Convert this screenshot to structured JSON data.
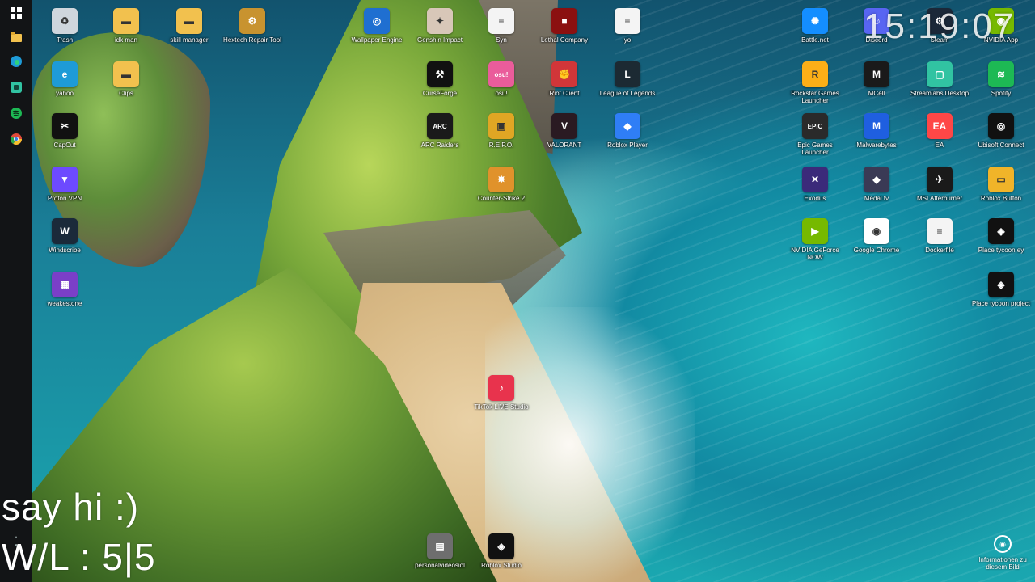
{
  "clock": "15:19:07",
  "overlay": {
    "line1": "say hi :)",
    "line2": "W/L : 5|5"
  },
  "info_corner": {
    "label": "Informationen zu diesem Bild"
  },
  "icons": [
    {
      "label": "Trash",
      "icon": "recycle-bin-icon",
      "color": "#cfd6dd",
      "glyph": "♻"
    },
    {
      "label": "idk man",
      "icon": "folder-icon",
      "color": "#f2c14e",
      "glyph": "▬"
    },
    {
      "label": "skill manager",
      "icon": "folder-icon",
      "color": "#f2c14e",
      "glyph": "▬"
    },
    {
      "label": "Hextech Repair Tool",
      "icon": "hextech-icon",
      "color": "#c8932f",
      "glyph": "⚙"
    },
    {
      "label": "Wallpaper Engine",
      "icon": "wallpaper-engine-icon",
      "color": "#1f6fd1",
      "glyph": "◎"
    },
    {
      "label": "Genshin Impact",
      "icon": "genshin-icon",
      "color": "#d8c7b8",
      "glyph": "✦"
    },
    {
      "label": "Syn",
      "icon": "document-icon",
      "color": "#f4f4f4",
      "glyph": "≡"
    },
    {
      "label": "Lethal Company",
      "icon": "lethal-company-icon",
      "color": "#8b1010",
      "glyph": "■"
    },
    {
      "label": "yo",
      "icon": "document-icon",
      "color": "#f4f4f4",
      "glyph": "≡"
    },
    {
      "label": "yahoo",
      "icon": "edge-icon",
      "color": "#1e9bd7",
      "glyph": "e"
    },
    {
      "label": "Clips",
      "icon": "folder-icon",
      "color": "#f2c14e",
      "glyph": "▬"
    },
    {
      "label": "CurseForge",
      "icon": "curseforge-icon",
      "color": "#111111",
      "glyph": "⚒"
    },
    {
      "label": "osu!",
      "icon": "osu-icon",
      "color": "#ea5c9b",
      "glyph": "osu!"
    },
    {
      "label": "Riot Client",
      "icon": "riot-client-icon",
      "color": "#d13639",
      "glyph": "✊"
    },
    {
      "label": "League of Legends",
      "icon": "league-icon",
      "color": "#1c2a33",
      "glyph": "L"
    },
    {
      "label": "CapCut",
      "icon": "capcut-icon",
      "color": "#111111",
      "glyph": "✂"
    },
    {
      "label": "ARC Raiders",
      "icon": "arc-raiders-icon",
      "color": "#1a1a1a",
      "glyph": "ARC"
    },
    {
      "label": "R.E.P.O.",
      "icon": "repo-icon",
      "color": "#e0a624",
      "glyph": "▣"
    },
    {
      "label": "VALORANT",
      "icon": "valorant-icon",
      "color": "#2a1a22",
      "glyph": "V"
    },
    {
      "label": "Roblox Player",
      "icon": "roblox-icon",
      "color": "#2f7ef6",
      "glyph": "◆"
    },
    {
      "label": "Proton VPN",
      "icon": "proton-vpn-icon",
      "color": "#6d4aff",
      "glyph": "▼"
    },
    {
      "label": "Counter-Strike 2",
      "icon": "cs2-icon",
      "color": "#e0922b",
      "glyph": "✸"
    },
    {
      "label": "Windscribe",
      "icon": "windscribe-icon",
      "color": "#1b2a3a",
      "glyph": "W"
    },
    {
      "label": "weakestone",
      "icon": "image-file-icon",
      "color": "#7a3fc8",
      "glyph": "▦"
    },
    {
      "label": "TikTok LIVE Studio",
      "icon": "tiktok-live-icon",
      "color": "#e8334d",
      "glyph": "♪"
    },
    {
      "label": "personalvideosiol",
      "icon": "archive-icon",
      "color": "#6e6e6e",
      "glyph": "▤"
    },
    {
      "label": "Roblox Studio",
      "icon": "roblox-studio-icon",
      "color": "#111111",
      "glyph": "◈"
    },
    {
      "label": "Battle.net",
      "icon": "battlenet-icon",
      "color": "#148eff",
      "glyph": "✺"
    },
    {
      "label": "Discord",
      "icon": "discord-icon",
      "color": "#5865f2",
      "glyph": "☺"
    },
    {
      "label": "Steam",
      "icon": "steam-icon",
      "color": "#1b2838",
      "glyph": "⚙"
    },
    {
      "label": "NVIDIA App",
      "icon": "nvidia-icon",
      "color": "#76b900",
      "glyph": "◉"
    },
    {
      "label": "Rockstar Games Launcher",
      "icon": "rockstar-icon",
      "color": "#fcaf17",
      "glyph": "R"
    },
    {
      "label": "MCell",
      "icon": "mcell-icon",
      "color": "#1a1a1a",
      "glyph": "M"
    },
    {
      "label": "Streamlabs Desktop",
      "icon": "streamlabs-icon",
      "color": "#31c3a2",
      "glyph": "▢"
    },
    {
      "label": "Spotify",
      "icon": "spotify-icon",
      "color": "#1db954",
      "glyph": "≋"
    },
    {
      "label": "Epic Games Launcher",
      "icon": "epic-games-icon",
      "color": "#2a2a2a",
      "glyph": "EPIC"
    },
    {
      "label": "Malwarebytes",
      "icon": "malwarebytes-icon",
      "color": "#1f5fe0",
      "glyph": "M"
    },
    {
      "label": "EA",
      "icon": "ea-icon",
      "color": "#ff4747",
      "glyph": "EA"
    },
    {
      "label": "Ubisoft Connect",
      "icon": "ubisoft-icon",
      "color": "#111111",
      "glyph": "◎"
    },
    {
      "label": "Exodus",
      "icon": "exodus-icon",
      "color": "#3b2a7a",
      "glyph": "✕"
    },
    {
      "label": "Medal.tv",
      "icon": "medal-icon",
      "color": "#3a3a55",
      "glyph": "◆"
    },
    {
      "label": "MSI Afterburner",
      "icon": "msi-afterburner-icon",
      "color": "#1a1a1a",
      "glyph": "✈"
    },
    {
      "label": "Roblox Button",
      "icon": "roblox-button-icon",
      "color": "#f0b429",
      "glyph": "▭"
    },
    {
      "label": "NVIDIA GeForce NOW",
      "icon": "geforce-now-icon",
      "color": "#76b900",
      "glyph": "▶"
    },
    {
      "label": "Google Chrome",
      "icon": "chrome-icon",
      "color": "#ffffff",
      "glyph": "◉"
    },
    {
      "label": "Dockerfile",
      "icon": "document-icon",
      "color": "#f4f4f4",
      "glyph": "≡"
    },
    {
      "label": "Place tycoon ey",
      "icon": "roblox-studio-icon",
      "color": "#111111",
      "glyph": "◈"
    },
    {
      "label": "Place tycoon project",
      "icon": "roblox-studio-icon",
      "color": "#111111",
      "glyph": "◈"
    }
  ],
  "taskbar": [
    {
      "icon": "windows-start-icon",
      "color": "#ffffff"
    },
    {
      "icon": "file-explorer-icon",
      "color": "#f2c14e"
    },
    {
      "icon": "edge-icon",
      "color": "#1e9bd7"
    },
    {
      "icon": "streamlabs-icon",
      "color": "#31c3a2"
    },
    {
      "icon": "spotify-icon",
      "color": "#1db954"
    },
    {
      "icon": "chrome-icon",
      "color": "#e04a3a"
    }
  ]
}
